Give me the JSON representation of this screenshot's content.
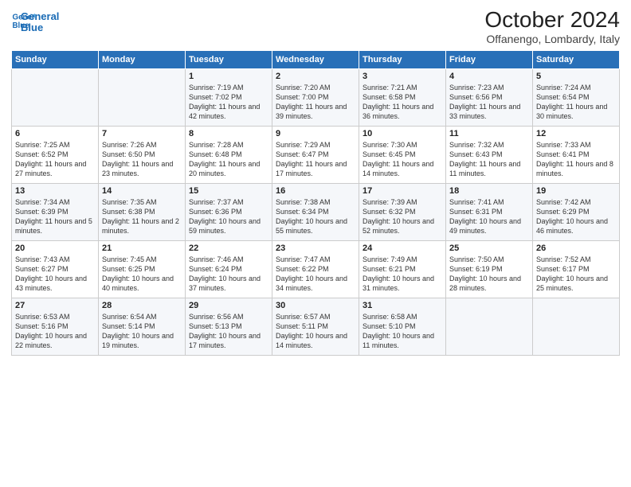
{
  "logo": {
    "line1": "General",
    "line2": "Blue"
  },
  "title": "October 2024",
  "subtitle": "Offanengo, Lombardy, Italy",
  "days_of_week": [
    "Sunday",
    "Monday",
    "Tuesday",
    "Wednesday",
    "Thursday",
    "Friday",
    "Saturday"
  ],
  "weeks": [
    [
      {
        "num": "",
        "info": ""
      },
      {
        "num": "",
        "info": ""
      },
      {
        "num": "1",
        "info": "Sunrise: 7:19 AM\nSunset: 7:02 PM\nDaylight: 11 hours and 42 minutes."
      },
      {
        "num": "2",
        "info": "Sunrise: 7:20 AM\nSunset: 7:00 PM\nDaylight: 11 hours and 39 minutes."
      },
      {
        "num": "3",
        "info": "Sunrise: 7:21 AM\nSunset: 6:58 PM\nDaylight: 11 hours and 36 minutes."
      },
      {
        "num": "4",
        "info": "Sunrise: 7:23 AM\nSunset: 6:56 PM\nDaylight: 11 hours and 33 minutes."
      },
      {
        "num": "5",
        "info": "Sunrise: 7:24 AM\nSunset: 6:54 PM\nDaylight: 11 hours and 30 minutes."
      }
    ],
    [
      {
        "num": "6",
        "info": "Sunrise: 7:25 AM\nSunset: 6:52 PM\nDaylight: 11 hours and 27 minutes."
      },
      {
        "num": "7",
        "info": "Sunrise: 7:26 AM\nSunset: 6:50 PM\nDaylight: 11 hours and 23 minutes."
      },
      {
        "num": "8",
        "info": "Sunrise: 7:28 AM\nSunset: 6:48 PM\nDaylight: 11 hours and 20 minutes."
      },
      {
        "num": "9",
        "info": "Sunrise: 7:29 AM\nSunset: 6:47 PM\nDaylight: 11 hours and 17 minutes."
      },
      {
        "num": "10",
        "info": "Sunrise: 7:30 AM\nSunset: 6:45 PM\nDaylight: 11 hours and 14 minutes."
      },
      {
        "num": "11",
        "info": "Sunrise: 7:32 AM\nSunset: 6:43 PM\nDaylight: 11 hours and 11 minutes."
      },
      {
        "num": "12",
        "info": "Sunrise: 7:33 AM\nSunset: 6:41 PM\nDaylight: 11 hours and 8 minutes."
      }
    ],
    [
      {
        "num": "13",
        "info": "Sunrise: 7:34 AM\nSunset: 6:39 PM\nDaylight: 11 hours and 5 minutes."
      },
      {
        "num": "14",
        "info": "Sunrise: 7:35 AM\nSunset: 6:38 PM\nDaylight: 11 hours and 2 minutes."
      },
      {
        "num": "15",
        "info": "Sunrise: 7:37 AM\nSunset: 6:36 PM\nDaylight: 10 hours and 59 minutes."
      },
      {
        "num": "16",
        "info": "Sunrise: 7:38 AM\nSunset: 6:34 PM\nDaylight: 10 hours and 55 minutes."
      },
      {
        "num": "17",
        "info": "Sunrise: 7:39 AM\nSunset: 6:32 PM\nDaylight: 10 hours and 52 minutes."
      },
      {
        "num": "18",
        "info": "Sunrise: 7:41 AM\nSunset: 6:31 PM\nDaylight: 10 hours and 49 minutes."
      },
      {
        "num": "19",
        "info": "Sunrise: 7:42 AM\nSunset: 6:29 PM\nDaylight: 10 hours and 46 minutes."
      }
    ],
    [
      {
        "num": "20",
        "info": "Sunrise: 7:43 AM\nSunset: 6:27 PM\nDaylight: 10 hours and 43 minutes."
      },
      {
        "num": "21",
        "info": "Sunrise: 7:45 AM\nSunset: 6:25 PM\nDaylight: 10 hours and 40 minutes."
      },
      {
        "num": "22",
        "info": "Sunrise: 7:46 AM\nSunset: 6:24 PM\nDaylight: 10 hours and 37 minutes."
      },
      {
        "num": "23",
        "info": "Sunrise: 7:47 AM\nSunset: 6:22 PM\nDaylight: 10 hours and 34 minutes."
      },
      {
        "num": "24",
        "info": "Sunrise: 7:49 AM\nSunset: 6:21 PM\nDaylight: 10 hours and 31 minutes."
      },
      {
        "num": "25",
        "info": "Sunrise: 7:50 AM\nSunset: 6:19 PM\nDaylight: 10 hours and 28 minutes."
      },
      {
        "num": "26",
        "info": "Sunrise: 7:52 AM\nSunset: 6:17 PM\nDaylight: 10 hours and 25 minutes."
      }
    ],
    [
      {
        "num": "27",
        "info": "Sunrise: 6:53 AM\nSunset: 5:16 PM\nDaylight: 10 hours and 22 minutes."
      },
      {
        "num": "28",
        "info": "Sunrise: 6:54 AM\nSunset: 5:14 PM\nDaylight: 10 hours and 19 minutes."
      },
      {
        "num": "29",
        "info": "Sunrise: 6:56 AM\nSunset: 5:13 PM\nDaylight: 10 hours and 17 minutes."
      },
      {
        "num": "30",
        "info": "Sunrise: 6:57 AM\nSunset: 5:11 PM\nDaylight: 10 hours and 14 minutes."
      },
      {
        "num": "31",
        "info": "Sunrise: 6:58 AM\nSunset: 5:10 PM\nDaylight: 10 hours and 11 minutes."
      },
      {
        "num": "",
        "info": ""
      },
      {
        "num": "",
        "info": ""
      }
    ]
  ]
}
